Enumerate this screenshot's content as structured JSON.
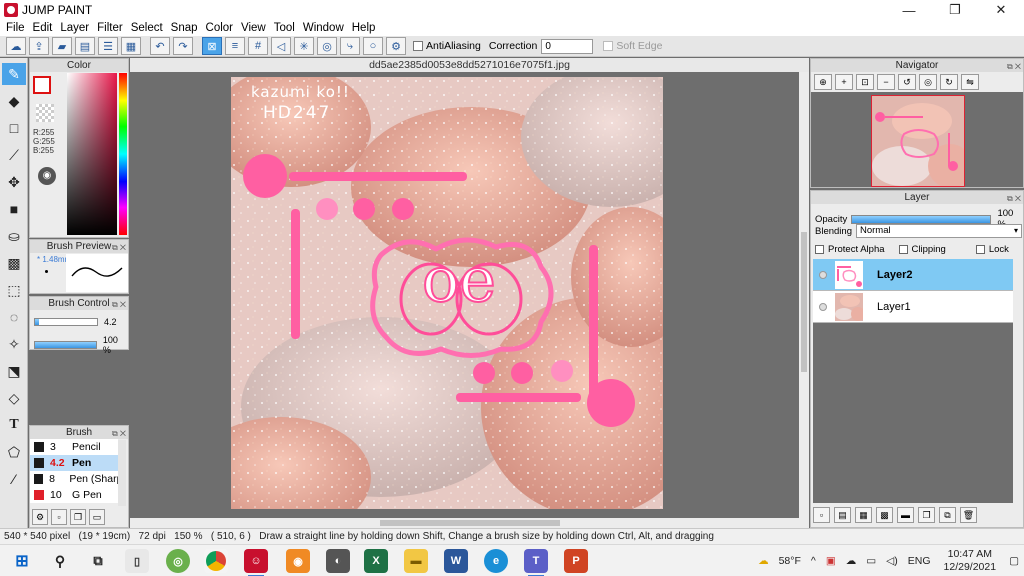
{
  "window": {
    "title": "JUMP PAINT",
    "controls": [
      "—",
      "❐",
      "✕"
    ]
  },
  "menu": [
    "File",
    "Edit",
    "Layer",
    "Filter",
    "Select",
    "Snap",
    "Color",
    "View",
    "Tool",
    "Window",
    "Help"
  ],
  "toolbar": {
    "antialiasing_label": "AntiAliasing",
    "correction_label": "Correction",
    "correction_value": "0",
    "soft_edge_label": "Soft Edge"
  },
  "color_panel": {
    "title": "Color",
    "r": "R:255",
    "g": "G:255",
    "b": "B:255",
    "fg_color": "#ffffff"
  },
  "brush_preview": {
    "title": "Brush Preview",
    "size": "* 1.48mm"
  },
  "brush_control": {
    "title": "Brush Control",
    "size_value": "4.2",
    "size_fraction": 0.06,
    "opacity_value": "100 %",
    "opacity_fraction": 1.0
  },
  "brush_panel": {
    "title": "Brush",
    "items": [
      {
        "size": "3",
        "name": "Pencil",
        "color": "#1a1a1a",
        "selected": false
      },
      {
        "size": "4.2",
        "name": "Pen",
        "color": "#1a1a1a",
        "selected": true
      },
      {
        "size": "8",
        "name": "Pen (Sharp",
        "color": "#1a1a1a",
        "selected": false
      },
      {
        "size": "10",
        "name": "G Pen",
        "color": "#e0202a",
        "selected": false
      }
    ]
  },
  "document": {
    "filename": "dd5ae2385d0053e8dd5271016e7075f1.jpg",
    "handwriting_line1": "kazumi ko!!",
    "handwriting_line2": "HD247",
    "badge_letters": "oe"
  },
  "navigator": {
    "title": "Navigator"
  },
  "layers": {
    "title": "Layer",
    "opacity_label": "Opacity",
    "opacity_value": "100 %",
    "blending_label": "Blending",
    "blending_value": "Normal",
    "protect_alpha_label": "Protect Alpha",
    "clipping_label": "Clipping",
    "lock_label": "Lock",
    "items": [
      {
        "name": "Layer2",
        "selected": true
      },
      {
        "name": "Layer1",
        "selected": false
      }
    ]
  },
  "status": {
    "size": "540 * 540 pixel",
    "physical": "(19 * 19cm)",
    "dpi": "72 dpi",
    "zoom": "150 %",
    "coords": "( 510, 6 )",
    "hint": "Draw a straight line by holding down Shift, Change a brush size by holding down Ctrl, Alt, and dragging"
  },
  "taskbar": {
    "weather": "58°F",
    "language": "ENG",
    "time": "10:47 AM",
    "date": "12/29/2021"
  },
  "colors": {
    "accent": "#4aa3e8",
    "pink": "#ff5fa2",
    "macaron": "#e6a79b"
  }
}
